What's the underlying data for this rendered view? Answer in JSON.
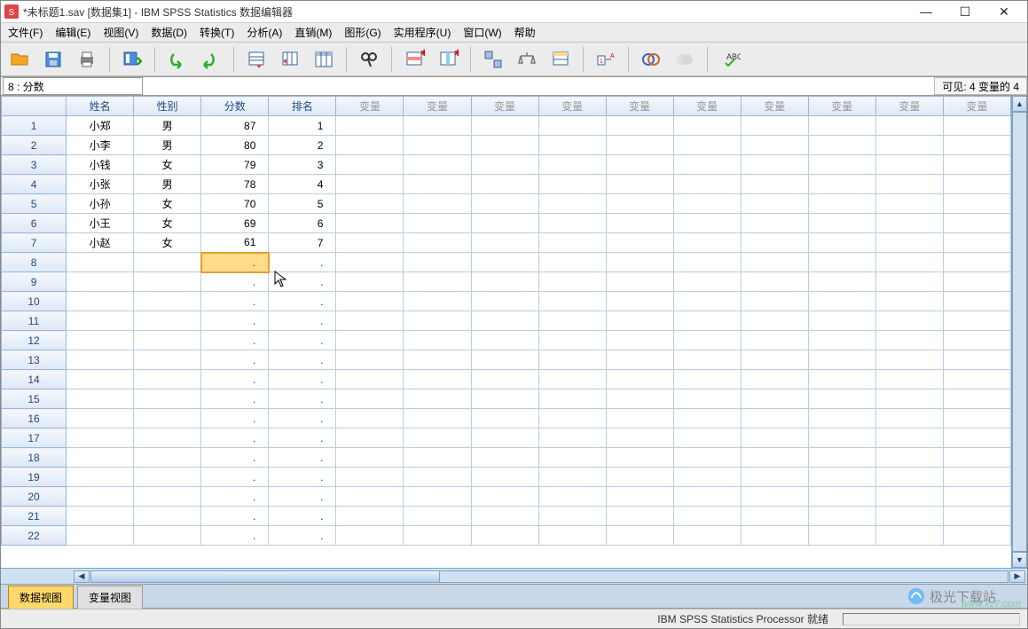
{
  "title": "*未标题1.sav [数据集1] - IBM SPSS Statistics 数据编辑器",
  "window_controls": {
    "min": "—",
    "max": "☐",
    "close": "✕"
  },
  "menus": [
    "文件(F)",
    "编辑(E)",
    "视图(V)",
    "数据(D)",
    "转换(T)",
    "分析(A)",
    "直销(M)",
    "图形(G)",
    "实用程序(U)",
    "窗口(W)",
    "帮助"
  ],
  "cell_ref": "8 : 分数",
  "visible_text": "可见:  4 变量的 4",
  "columns": [
    "姓名",
    "性别",
    "分数",
    "排名"
  ],
  "empty_var_label": "变量",
  "rows": [
    {
      "name": "小郑",
      "gender": "男",
      "score": "87",
      "rank": "1"
    },
    {
      "name": "小李",
      "gender": "男",
      "score": "80",
      "rank": "2"
    },
    {
      "name": "小钱",
      "gender": "女",
      "score": "79",
      "rank": "3"
    },
    {
      "name": "小张",
      "gender": "男",
      "score": "78",
      "rank": "4"
    },
    {
      "name": "小孙",
      "gender": "女",
      "score": "70",
      "rank": "5"
    },
    {
      "name": "小王",
      "gender": "女",
      "score": "69",
      "rank": "6"
    },
    {
      "name": "小赵",
      "gender": "女",
      "score": "61",
      "rank": "7"
    }
  ],
  "total_rows": 22,
  "empty_var_cols": 10,
  "selected_cell": {
    "row": 8,
    "col": "score"
  },
  "tabs": {
    "data": "数据视图",
    "var": "变量视图"
  },
  "status": "IBM SPSS Statistics Processor 就绪",
  "watermark_site": "www.xz7.com",
  "watermark_text": "极光下载站",
  "toolbar_icons": [
    "open",
    "save",
    "print",
    "recent",
    "undo",
    "redo",
    "goto",
    "vars",
    "cases",
    "find",
    "chart1",
    "chart2",
    "weight",
    "split",
    "select",
    "labels",
    "sets1",
    "sets2",
    "spell"
  ]
}
